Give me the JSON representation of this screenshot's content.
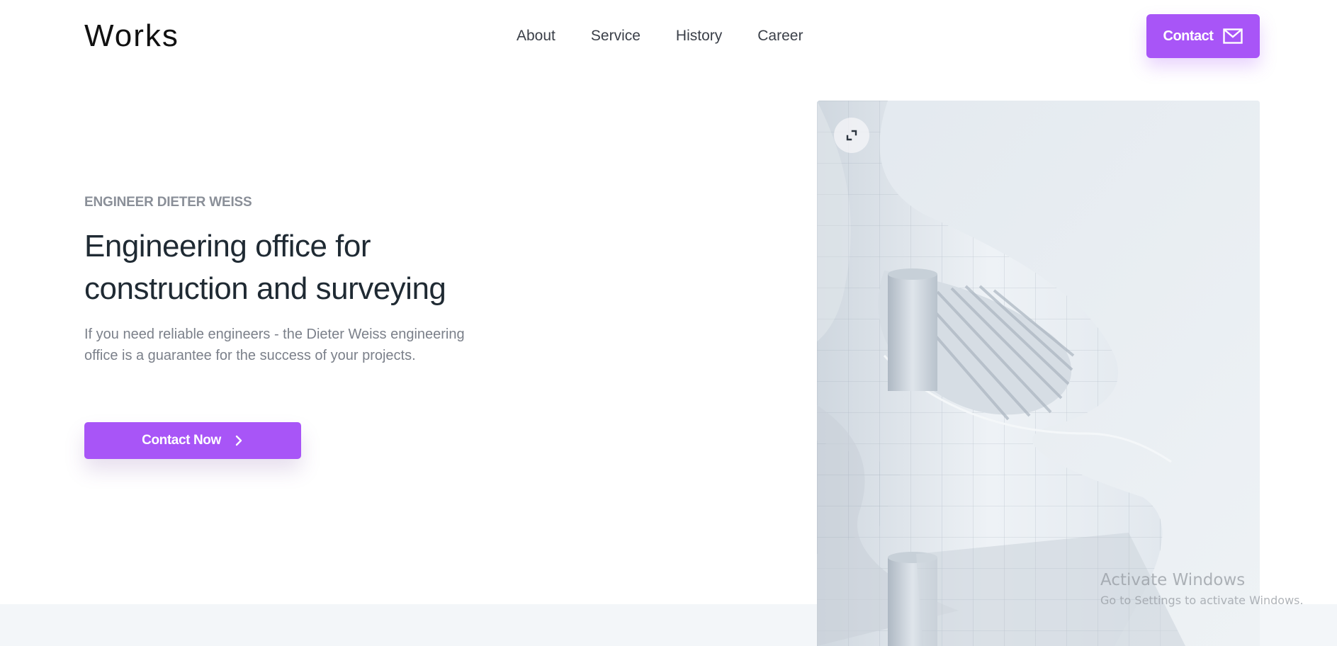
{
  "brand": {
    "logo": "Works"
  },
  "nav": {
    "items": [
      {
        "label": "About"
      },
      {
        "label": "Service"
      },
      {
        "label": "History"
      },
      {
        "label": "Career"
      }
    ]
  },
  "header": {
    "contact_label": "Contact",
    "contact_icon": "mail-icon"
  },
  "hero": {
    "eyebrow": "ENGINEER DIETER WEISS",
    "headline": "Engineering office for construction and surveying",
    "intro": "If you need reliable engineers - the Dieter Weiss engineering office is a guarantee for the success of your projects.",
    "cta_label": "Contact Now",
    "cta_icon": "chevron-right-icon",
    "image_action_icon": "expand-icon"
  },
  "watermark": {
    "title": "Activate Windows",
    "subtitle": "Go to Settings to activate Windows."
  },
  "colors": {
    "accent": "#a855f7",
    "heading": "#1f2a33",
    "muted": "#7b808a",
    "band": "#f3f6f9"
  }
}
